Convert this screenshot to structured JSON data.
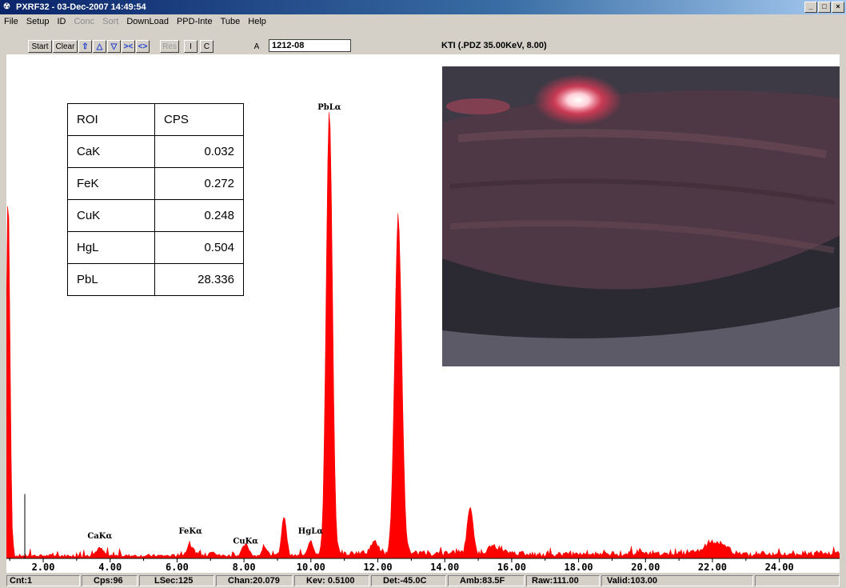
{
  "window": {
    "title": "PXRF32 - 03-Dec-2007 14:49:54",
    "buttons": {
      "minimize": "_",
      "maximize": "□",
      "close": "×"
    }
  },
  "menu": [
    "File",
    "Setup",
    "ID",
    "Conc",
    "Sort",
    "DownLoad",
    "PPD-Inte",
    "Tube",
    "Help"
  ],
  "toolbar": {
    "start": "Start",
    "clear": "Clear",
    "nav_icons": [
      "up-arrow-icon",
      "scroll-up-icon",
      "scroll-down-icon",
      "zoom-in-icon",
      "zoom-out-icon"
    ],
    "res": "Res",
    "i": "I",
    "c": "C",
    "a": "A",
    "sample_id": "1212-08",
    "header": "KTI  (.PDZ 35.00KeV, 8.00)"
  },
  "roi_table": {
    "headers": [
      "ROI",
      "CPS"
    ],
    "rows": [
      {
        "roi": "CaK",
        "cps": "0.032"
      },
      {
        "roi": "FeK",
        "cps": "0.272"
      },
      {
        "roi": "CuK",
        "cps": "0.248"
      },
      {
        "roi": "HgL",
        "cps": "0.504"
      },
      {
        "roi": "PbL",
        "cps": "28.336"
      }
    ]
  },
  "chart_data": {
    "type": "bar",
    "xlim": [
      0.9,
      25.8
    ],
    "ylim": [
      0,
      100
    ],
    "x_ticks": [
      "2.00",
      "4.00",
      "6.00",
      "8.00",
      "10.00",
      "12.00",
      "14.00",
      "16.00",
      "18.00",
      "20.00",
      "22.00",
      "24.00"
    ],
    "x_tick_values": [
      2,
      4,
      6,
      8,
      10,
      12,
      14,
      16,
      18,
      20,
      22,
      24
    ],
    "color": "#ff0000",
    "peaks": [
      {
        "kev": 0.95,
        "height": 73,
        "width": 0.08
      },
      {
        "kev": 3.69,
        "height": 1.5,
        "width": 0.15
      },
      {
        "kev": 6.4,
        "height": 2.0,
        "width": 0.15
      },
      {
        "kev": 7.06,
        "height": 1.0,
        "width": 0.12
      },
      {
        "kev": 8.05,
        "height": 2.2,
        "width": 0.14
      },
      {
        "kev": 8.63,
        "height": 1.5,
        "width": 0.12
      },
      {
        "kev": 9.2,
        "height": 8.0,
        "width": 0.1
      },
      {
        "kev": 9.99,
        "height": 3.0,
        "width": 0.12
      },
      {
        "kev": 10.55,
        "height": 89,
        "width": 0.13
      },
      {
        "kev": 11.9,
        "height": 2.5,
        "width": 0.15
      },
      {
        "kev": 12.61,
        "height": 67,
        "width": 0.15
      },
      {
        "kev": 14.76,
        "height": 9.5,
        "width": 0.12
      },
      {
        "kev": 15.5,
        "height": 1.5,
        "width": 0.3
      },
      {
        "kev": 22.1,
        "height": 2.5,
        "width": 0.4
      }
    ],
    "annotations": [
      {
        "label": "PbLα",
        "kev": 10.55,
        "y": 90.5
      },
      {
        "label": "CaKα",
        "kev": 3.69,
        "y": 4.0
      },
      {
        "label": "FeKα",
        "kev": 6.4,
        "y": 5.0
      },
      {
        "label": "CuKα",
        "kev": 8.05,
        "y": 3.0
      },
      {
        "label": "HgLα",
        "kev": 9.99,
        "y": 5.0
      }
    ],
    "marker_kev": 1.45
  },
  "status": [
    "Cnt:1",
    "Cps:96",
    "LSec:125",
    "Chan:20.079",
    "Kev: 0.5100",
    "Det:-45.0C",
    "Amb:83.5F",
    "Raw:111.00",
    "Valid:103.00"
  ]
}
